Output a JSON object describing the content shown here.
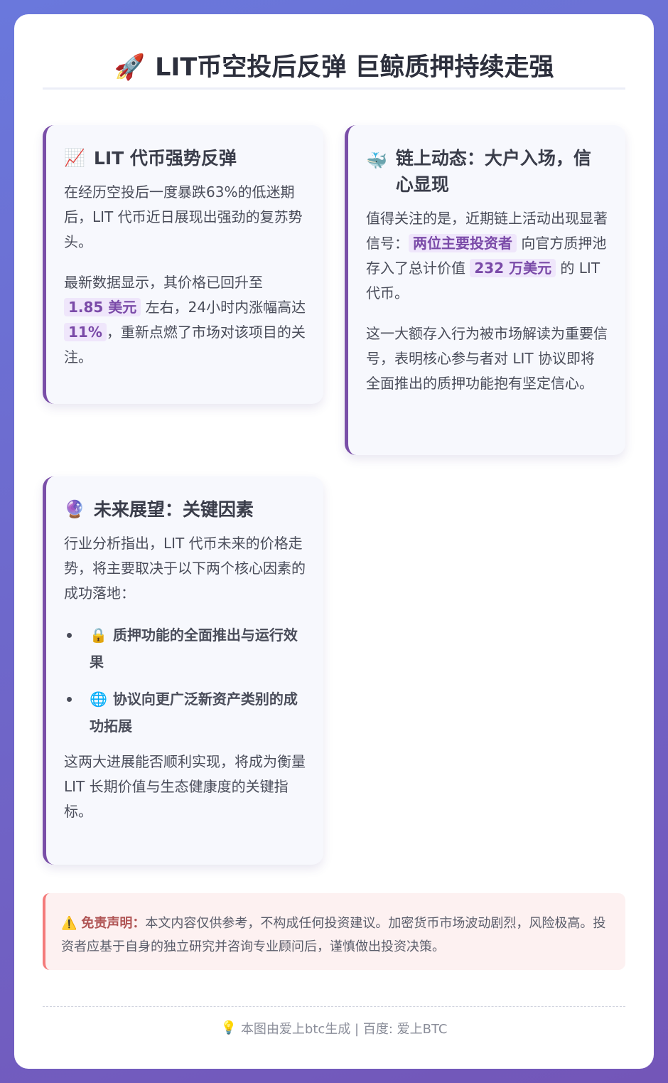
{
  "header": {
    "icon": "🚀",
    "title": "LIT币空投后反弹 巨鲸质押持续走强"
  },
  "sections": [
    {
      "icon": "📈",
      "title": "LIT 代币强势反弹",
      "p1": "在经历空投后一度暴跌63%的低迷期后，LIT 代币近日展现出强劲的复苏势头。",
      "p2_pre": "最新数据显示，其价格已回升至 ",
      "p2_hl1": "1.85 美元",
      "p2_mid": " 左右，24小时内涨幅高达 ",
      "p2_hl2": "11%",
      "p2_post": "，重新点燃了市场对该项目的关注。"
    },
    {
      "icon": "🐳",
      "title": "链上动态：大户入场，信心显现",
      "p1_pre": "值得关注的是，近期链上活动出现显著信号：",
      "p1_hl1": "两位主要投资者",
      "p1_mid": " 向官方质押池存入了总计价值 ",
      "p1_hl2": "232 万美元",
      "p1_post": " 的 LIT 代币。",
      "p2": "这一大额存入行为被市场解读为重要信号，表明核心参与者对 LIT 协议即将全面推出的质押功能抱有坚定信心。"
    },
    {
      "icon": "🔮",
      "title": "未来展望：关键因素",
      "p1": "行业分析指出，LIT 代币未来的价格走势，将主要取决于以下两个核心因素的成功落地：",
      "items": [
        {
          "icon": "🔒",
          "text": "质押功能的全面推出与运行效果"
        },
        {
          "icon": "🌐",
          "text": "协议向更广泛新资产类别的成功拓展"
        }
      ],
      "p2": "这两大进展能否顺利实现，将成为衡量 LIT 长期价值与生态健康度的关键指标。"
    }
  ],
  "disclaimer": {
    "icon": "⚠️",
    "label": "免责声明：",
    "text": "本文内容仅供参考，不构成任何投资建议。加密货币市场波动剧烈，风险极高。投资者应基于自身的独立研究并咨询专业顾问后，谨慎做出投资决策。"
  },
  "footer": {
    "icon": "💡",
    "text": "本图由爱上btc生成 | 百度: 爱上BTC"
  }
}
